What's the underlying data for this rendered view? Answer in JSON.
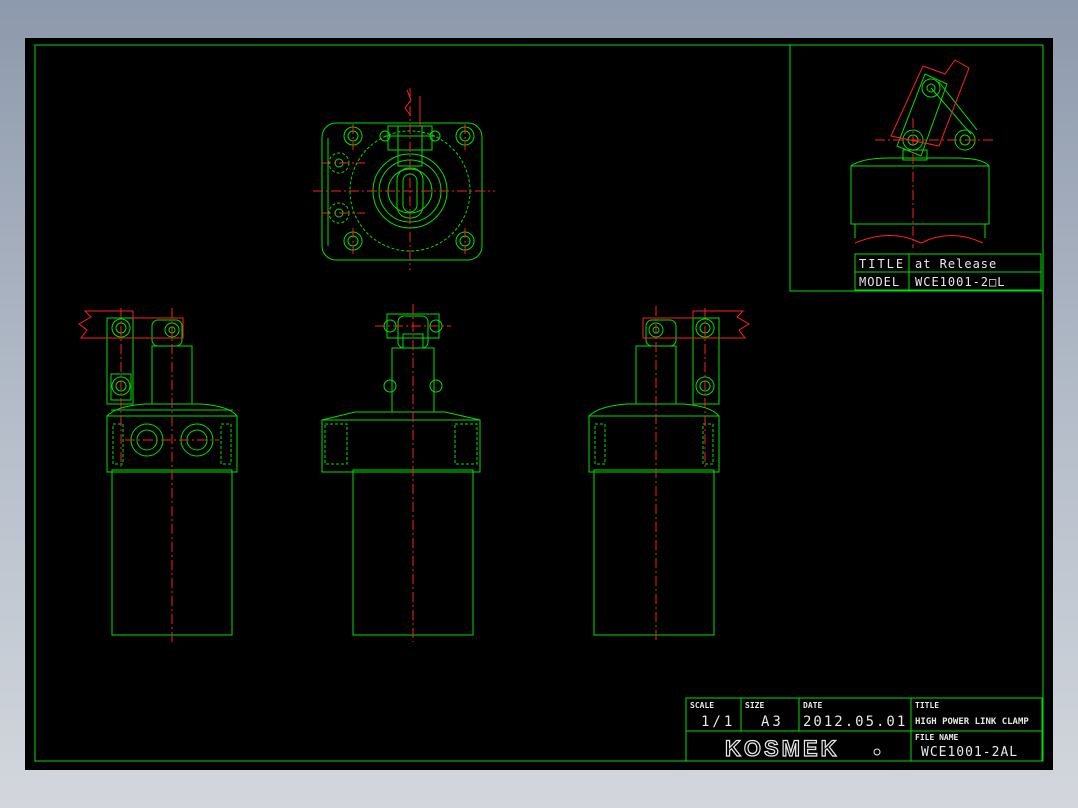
{
  "title_block": {
    "scale_label": "SCALE",
    "scale_value": "1/1",
    "size_label": "SIZE",
    "size_value": "A3",
    "date_label": "DATE",
    "date_value": "2012.05.01",
    "title_label": "TITLE",
    "title_value": "HIGH POWER LINK CLAMP",
    "file_name_label": "FILE NAME",
    "file_name_value": "WCE1001-2AL",
    "logo_text": "KOSMEK"
  },
  "inset": {
    "title_label": "TITLE",
    "title_value": "at Release",
    "model_label": "MODEL",
    "model_value": "WCE1001-2□L"
  },
  "colors": {
    "background": "#000000",
    "outline": "#00e000",
    "centerline": "#ff2020",
    "text": "#e8e8e8"
  }
}
